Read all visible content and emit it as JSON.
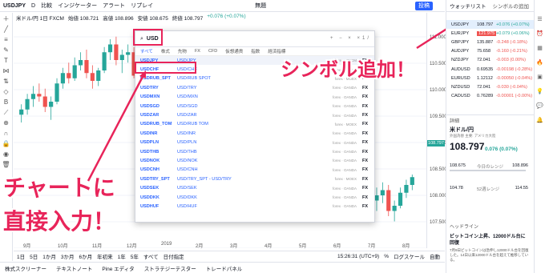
{
  "topbar": {
    "symbol": "USDJPY",
    "interval": "D",
    "compare": "比較",
    "indicators": "インジケーター",
    "alert": "アラート",
    "replay": "リプレイ",
    "unnamed": "無題",
    "publish": "投稿"
  },
  "legend": {
    "name": "米ドル/円 1日 FXCM",
    "open": "始値 108.721",
    "high": "高値 108.896",
    "low": "安値 108.675",
    "close": "終値 108.797",
    "change": "+0.076 (+0.07%)"
  },
  "search": {
    "value": "USD",
    "categories": [
      "すべて",
      "株式",
      "先物",
      "FX",
      "CFD",
      "仮想通貨",
      "指数",
      "経済指標"
    ],
    "results": [
      {
        "symbol": "USDJPY",
        "desc": "USD/JPY",
        "exchange": "forex · FXCM",
        "type": "FX"
      },
      {
        "symbol": "USDCHF",
        "desc": "USD/CHF",
        "exchange": "forex · OANDA",
        "type": "FX"
      },
      {
        "symbol": "USDRUB_SPT",
        "desc": "USD/RUB SPOT",
        "exchange": "forex · MOEX",
        "type": "FX"
      },
      {
        "symbol": "USDTRY",
        "desc": "USD/TRY",
        "exchange": "forex · OANDA",
        "type": "FX"
      },
      {
        "symbol": "USDMXN",
        "desc": "USD/MXN",
        "exchange": "forex · OANDA",
        "type": "FX"
      },
      {
        "symbol": "USDSGD",
        "desc": "USD/SGD",
        "exchange": "forex · OANDA",
        "type": "FX"
      },
      {
        "symbol": "USDZAR",
        "desc": "USD/ZAR",
        "exchange": "forex · OANDA",
        "type": "FX"
      },
      {
        "symbol": "USDRUB_TOM",
        "desc": "USD/RUB TOM",
        "exchange": "forex · MOEX",
        "type": "FX"
      },
      {
        "symbol": "USDINR",
        "desc": "USD/INR",
        "exchange": "forex · OANDA",
        "type": "FX"
      },
      {
        "symbol": "USDPLN",
        "desc": "USD/PLN",
        "exchange": "forex · OANDA",
        "type": "FX"
      },
      {
        "symbol": "USDTHB",
        "desc": "USD/THB",
        "exchange": "forex · OANDA",
        "type": "FX"
      },
      {
        "symbol": "USDNOK",
        "desc": "USD/NOK",
        "exchange": "forex · OANDA",
        "type": "FX"
      },
      {
        "symbol": "USDCNH",
        "desc": "USD/CNH",
        "exchange": "forex · OANDA",
        "type": "FX"
      },
      {
        "symbol": "USDTRY_SPT",
        "desc": "USD/TRY_SPT - USD/TRY",
        "exchange": "forex · MOEX",
        "type": "FX"
      },
      {
        "symbol": "USDSEK",
        "desc": "USD/SEK",
        "exchange": "forex · OANDA",
        "type": "FX"
      },
      {
        "symbol": "USDDKK",
        "desc": "USD/DKK",
        "exchange": "forex · OANDA",
        "type": "FX"
      },
      {
        "symbol": "USDHUF",
        "desc": "USD/HUF",
        "exchange": "forex · OANDA",
        "type": "FX"
      }
    ]
  },
  "annotations": {
    "right": "シンボル追加！",
    "left_line1": "チャートに",
    "left_line2": "直接入力！"
  },
  "sidebar": {
    "title": "ウォッチリスト",
    "add_symbol": "シンボルの追加",
    "watchlist": [
      {
        "symbol": "USDJPY",
        "price": "108.797",
        "change": "+0.076 (+0.07%)",
        "dir": "up"
      },
      {
        "symbol": "EURJPY",
        "price": "121.975",
        "change": "+0.079 (+0.06%)",
        "dir": "up"
      },
      {
        "symbol": "GBPJPY",
        "price": "135.887",
        "change": "-0.248 (-0.18%)",
        "dir": "dn"
      },
      {
        "symbol": "AUDJPY",
        "price": "75.658",
        "change": "-0.160 (-0.21%)",
        "dir": "dn"
      },
      {
        "symbol": "NZDJPY",
        "price": "72.041",
        "change": "-0.003 (0.00%)",
        "dir": "dn"
      },
      {
        "symbol": "AUDUSD",
        "price": "0.69535",
        "change": "-0.00198 (-0.28%)",
        "dir": "dn"
      },
      {
        "symbol": "EURUSD",
        "price": "1.12112",
        "change": "-0.00050 (-0.04%)",
        "dir": "dn"
      },
      {
        "symbol": "NZDUSD",
        "price": "72.041",
        "change": "-0.030 (-0.04%)",
        "dir": "dn"
      },
      {
        "symbol": "CADUSD",
        "price": "0.76289",
        "change": "-0.00001 (-0.00%)",
        "dir": "dn"
      }
    ],
    "detail": {
      "header": "詳細",
      "symbol": "米ドル/円",
      "sub": "外国為替 主要: アメリカ大陸",
      "price": "108.797",
      "change": "0.076 (0.07%)",
      "day_low": "108.675",
      "day_high": "108.896",
      "day_label": "今日のレンジ",
      "year_low": "104.78",
      "year_high": "114.55",
      "year_label": "52週レンジ"
    },
    "news_header": "ヘッドライン",
    "news_title": "ビットコイン上昇、12000ドル台に回復",
    "news_body": "7月9日ビットコインは急伸し12000ドル台を回復した。14日以来12000ドル台を超えて推移している。"
  },
  "priceaxis": [
    "111.000",
    "110.500",
    "110.000",
    "109.500",
    "109.000",
    "108.500",
    "108.000",
    "107.500"
  ],
  "timeaxis": [
    "9月",
    "10月",
    "11月",
    "12月",
    "2019",
    "2月",
    "3月",
    "4月",
    "5月",
    "6月",
    "7月",
    "8月"
  ],
  "bottom": {
    "ranges": [
      "1日",
      "5日",
      "1か月",
      "3か月",
      "6か月",
      "年初来",
      "1年",
      "5年",
      "すべて",
      "日付指定"
    ],
    "time": "15:26:31 (UTC+9)",
    "pct": "%",
    "log": "ログスケール",
    "auto": "自動"
  },
  "panels": [
    "株式スクリーナー",
    "テキストノート",
    "Pine エディタ",
    "ストラテジーテスター",
    "トレードパネル"
  ],
  "chart_data": {
    "type": "candlestick",
    "price_tag": "108.797",
    "candles": [
      [
        111.2,
        111.6,
        110.9,
        111.4
      ],
      [
        111.4,
        112.0,
        111.2,
        111.8
      ],
      [
        111.8,
        112.3,
        111.5,
        112.0
      ],
      [
        112.0,
        112.4,
        111.7,
        111.9
      ],
      [
        111.9,
        112.2,
        111.3,
        111.5
      ],
      [
        111.5,
        111.9,
        111.0,
        111.7
      ],
      [
        111.7,
        112.6,
        111.6,
        112.4
      ],
      [
        112.4,
        113.0,
        112.2,
        112.8
      ],
      [
        112.8,
        113.2,
        112.4,
        112.6
      ],
      [
        112.6,
        113.4,
        112.5,
        113.1
      ],
      [
        113.1,
        113.6,
        112.9,
        113.3
      ],
      [
        113.3,
        113.7,
        112.6,
        112.8
      ],
      [
        112.8,
        113.1,
        112.2,
        112.5
      ],
      [
        112.5,
        113.0,
        112.3,
        112.9
      ],
      [
        112.9,
        113.8,
        112.8,
        113.6
      ],
      [
        113.6,
        114.1,
        113.3,
        113.9
      ],
      [
        113.9,
        114.2,
        113.1,
        113.3
      ],
      [
        113.3,
        113.7,
        112.8,
        113.5
      ],
      [
        113.5,
        113.9,
        113.2,
        113.6
      ],
      [
        113.6,
        113.8,
        112.6,
        112.7
      ],
      [
        112.7,
        113.0,
        112.1,
        112.3
      ],
      [
        112.3,
        112.9,
        112.0,
        112.7
      ],
      [
        112.7,
        113.2,
        112.5,
        113.0
      ],
      [
        113.0,
        113.3,
        112.2,
        112.4
      ],
      [
        112.4,
        112.6,
        111.4,
        111.6
      ],
      [
        111.6,
        111.8,
        110.7,
        110.9
      ],
      [
        110.9,
        111.2,
        110.2,
        110.4
      ],
      [
        110.4,
        110.6,
        108.5,
        109.0
      ],
      [
        109.0,
        109.5,
        107.8,
        108.3
      ],
      [
        108.3,
        109.2,
        108.0,
        108.9
      ],
      [
        108.9,
        109.8,
        108.7,
        109.6
      ],
      [
        109.6,
        110.1,
        109.3,
        109.8
      ],
      [
        109.8,
        110.3,
        109.5,
        109.7
      ],
      [
        109.7,
        110.0,
        109.2,
        109.5
      ],
      [
        109.5,
        110.5,
        109.4,
        110.3
      ],
      [
        110.3,
        110.9,
        110.1,
        110.7
      ],
      [
        110.7,
        111.1,
        110.2,
        110.5
      ],
      [
        110.5,
        110.8,
        110.0,
        110.4
      ],
      [
        110.4,
        111.0,
        110.3,
        110.8
      ],
      [
        110.8,
        111.4,
        110.6,
        111.2
      ],
      [
        111.2,
        111.5,
        110.7,
        110.9
      ],
      [
        110.9,
        111.3,
        110.5,
        111.1
      ],
      [
        111.1,
        111.6,
        110.8,
        111.4
      ],
      [
        111.4,
        111.8,
        111.0,
        111.3
      ],
      [
        111.3,
        111.5,
        110.6,
        110.8
      ],
      [
        110.8,
        111.1,
        110.3,
        110.6
      ],
      [
        110.6,
        111.0,
        110.4,
        110.9
      ],
      [
        110.9,
        111.7,
        110.8,
        111.5
      ],
      [
        111.5,
        112.0,
        111.2,
        111.7
      ],
      [
        111.7,
        112.1,
        111.3,
        111.5
      ],
      [
        111.5,
        111.8,
        110.9,
        111.0
      ],
      [
        111.0,
        111.3,
        110.3,
        110.5
      ],
      [
        110.5,
        110.7,
        109.8,
        110.0
      ],
      [
        110.0,
        110.4,
        109.5,
        109.7
      ],
      [
        109.7,
        110.1,
        109.3,
        109.9
      ],
      [
        109.9,
        110.0,
        109.2,
        109.4
      ],
      [
        109.4,
        109.6,
        108.6,
        108.8
      ],
      [
        108.8,
        109.1,
        108.3,
        108.5
      ],
      [
        108.5,
        108.8,
        107.9,
        108.2
      ],
      [
        108.2,
        108.5,
        107.6,
        107.9
      ],
      [
        107.9,
        108.4,
        107.5,
        108.1
      ],
      [
        108.1,
        108.6,
        107.8,
        108.3
      ],
      [
        108.3,
        108.5,
        107.3,
        107.5
      ],
      [
        107.5,
        107.9,
        107.1,
        107.7
      ],
      [
        107.7,
        108.4,
        107.6,
        108.2
      ],
      [
        108.2,
        108.7,
        108.0,
        108.5
      ],
      [
        108.5,
        108.9,
        108.3,
        108.8
      ]
    ]
  }
}
